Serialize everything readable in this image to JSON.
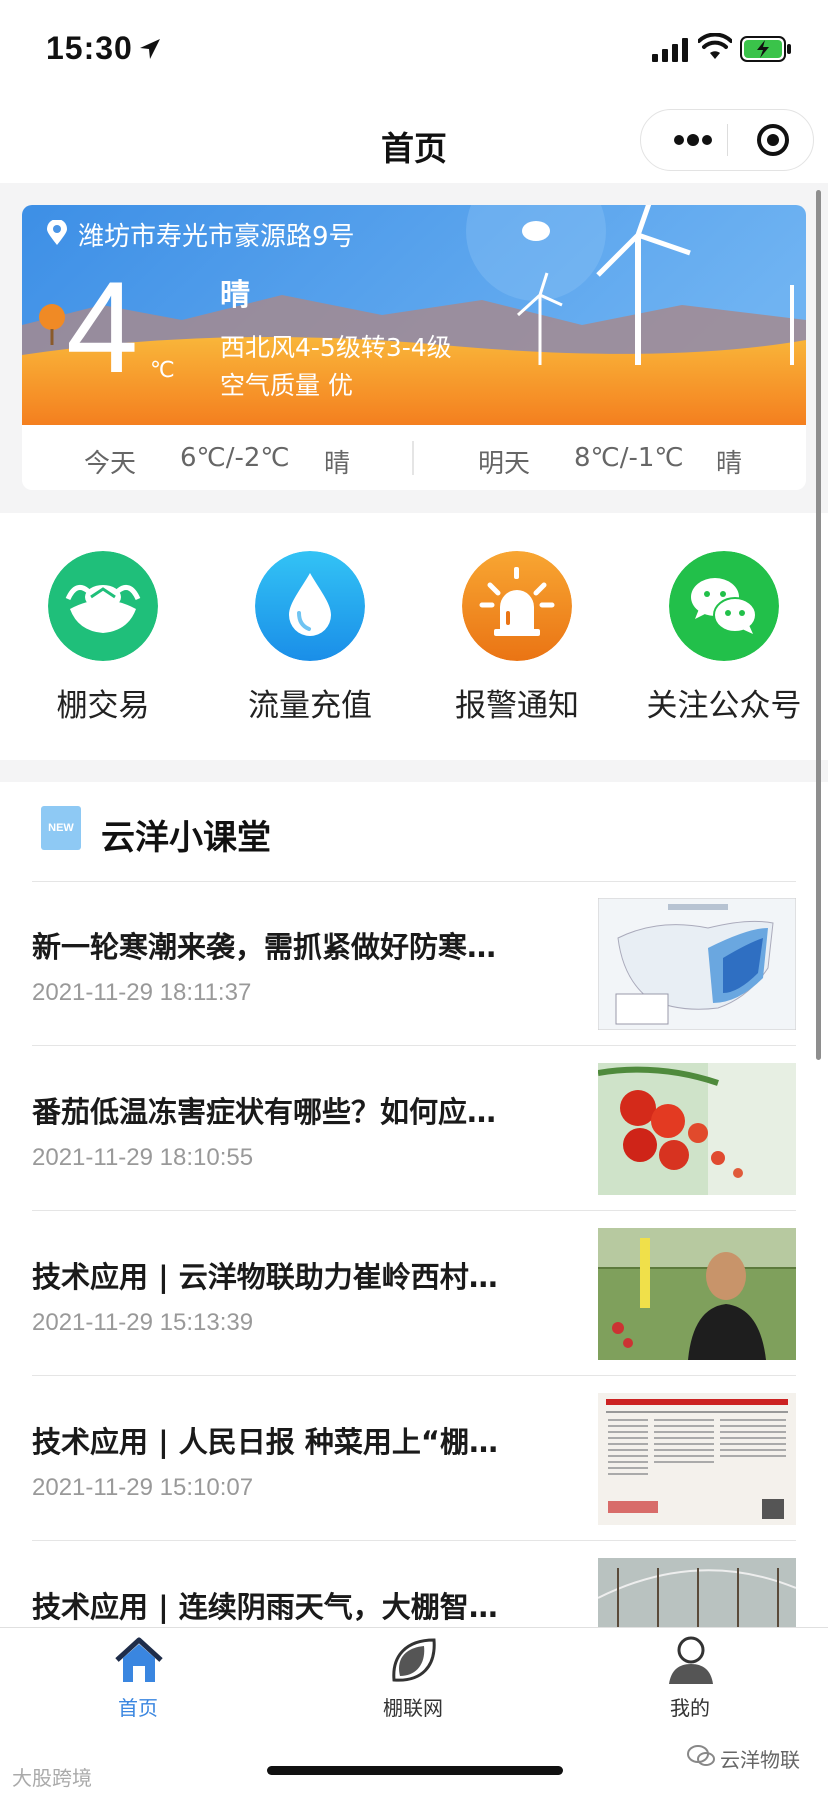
{
  "status_bar": {
    "time": "15:30"
  },
  "nav": {
    "title": "首页"
  },
  "weather": {
    "address": "潍坊市寿光市豪源路9号",
    "temp": "4",
    "unit": "℃",
    "condition": "晴",
    "wind": "西北风4-5级转3-4级",
    "air_quality": "空气质量 优",
    "today": {
      "label": "今天",
      "range": "6℃/-2℃",
      "cond": "晴"
    },
    "tomorrow": {
      "label": "明天",
      "range": "8℃/-1℃",
      "cond": "晴"
    }
  },
  "shortcuts": [
    {
      "label": "棚交易",
      "icon": "greenhouse-trade-icon",
      "color": "#1fbf7a"
    },
    {
      "label": "流量充值",
      "icon": "water-drop-icon",
      "color": "#1ea7ef"
    },
    {
      "label": "报警通知",
      "icon": "alarm-light-icon",
      "color": "#f08a1c"
    },
    {
      "label": "关注公众号",
      "icon": "wechat-icon",
      "color": "#22c04a"
    }
  ],
  "section": {
    "badge": "NEW",
    "title": "云洋小课堂"
  },
  "news": [
    {
      "title": "新一轮寒潮来袭，需抓紧做好防寒…",
      "date": "2021-11-29 18:11:37"
    },
    {
      "title": "番茄低温冻害症状有哪些？如何应…",
      "date": "2021-11-29 18:10:55"
    },
    {
      "title": "技术应用 | 云洋物联助力崔岭西村…",
      "date": "2021-11-29 15:13:39"
    },
    {
      "title": "技术应用 | 人民日报 种菜用上“棚…",
      "date": "2021-11-29 15:10:07"
    },
    {
      "title": "技术应用 | 连续阴雨天气，大棚智…",
      "date": ""
    }
  ],
  "tabs": [
    {
      "label": "首页",
      "active": true
    },
    {
      "label": "棚联网",
      "active": false
    },
    {
      "label": "我的",
      "active": false
    }
  ],
  "watermarks": {
    "left": "大股跨境",
    "right": "云洋物联"
  },
  "colors": {
    "accent": "#3a86e0",
    "tab_active": "#3a86e0",
    "tab_inactive": "#333333"
  }
}
